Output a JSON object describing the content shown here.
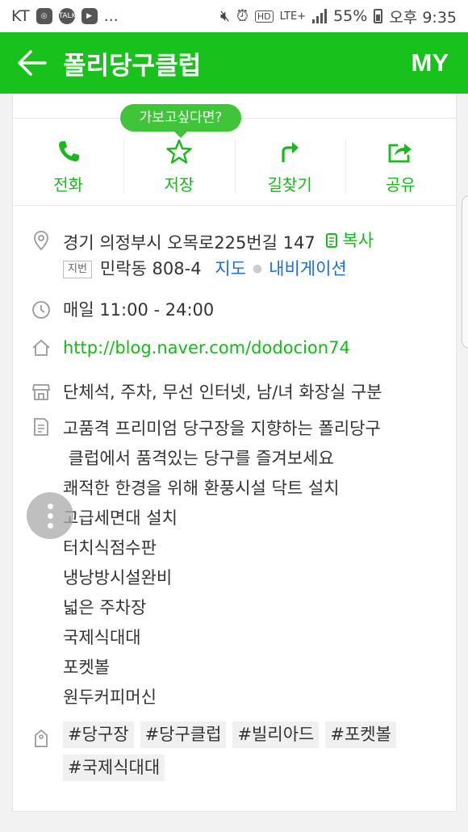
{
  "status_bar": {
    "carrier": "KT",
    "left_icons": [
      "instagram-icon",
      "talk-icon",
      "youtube-icon"
    ],
    "more": "...",
    "network": "LTE+",
    "battery": "55%",
    "time": "오후 9:35"
  },
  "header": {
    "title": "폴리당구클럽",
    "my_label": "MY"
  },
  "tooltip": "가보고싶다면?",
  "actions": [
    {
      "label": "전화",
      "icon": "phone-icon"
    },
    {
      "label": "저장",
      "icon": "star-icon"
    },
    {
      "label": "길찾기",
      "icon": "directions-icon"
    },
    {
      "label": "공유",
      "icon": "share-icon"
    }
  ],
  "address": {
    "road": "경기 의정부시 오목로225번길 147",
    "copy_label": "복사",
    "jibun_label": "지번",
    "jibun": "민락동 808-4",
    "map_label": "지도",
    "navi_label": "내비게이션"
  },
  "hours": "매일 11:00 - 24:00",
  "homepage": "http://blog.naver.com/dodocion74",
  "facilities": "단체석, 주차, 무선 인터넷, 남/녀 화장실 구분",
  "description": [
    "고품격 프리미엄 당구장을 지향하는 폴리당구",
    " 클럽에서 품격있는 당구를 즐겨보세요",
    "쾌적한 한경을 위해 환풍시설 닥트 설치",
    "고급세면대 설치",
    "터치식점수판",
    "냉낭방시설완비",
    "넓은 주차장",
    "국제식대대",
    "포켓볼",
    "원두커피머신"
  ],
  "tags": [
    "#당구장",
    "#당구클럽",
    "#빌리아드",
    "#포켓볼",
    "#국제식대대"
  ],
  "colors": {
    "brand": "#19c11c",
    "link_blue": "#1b6fd1"
  }
}
